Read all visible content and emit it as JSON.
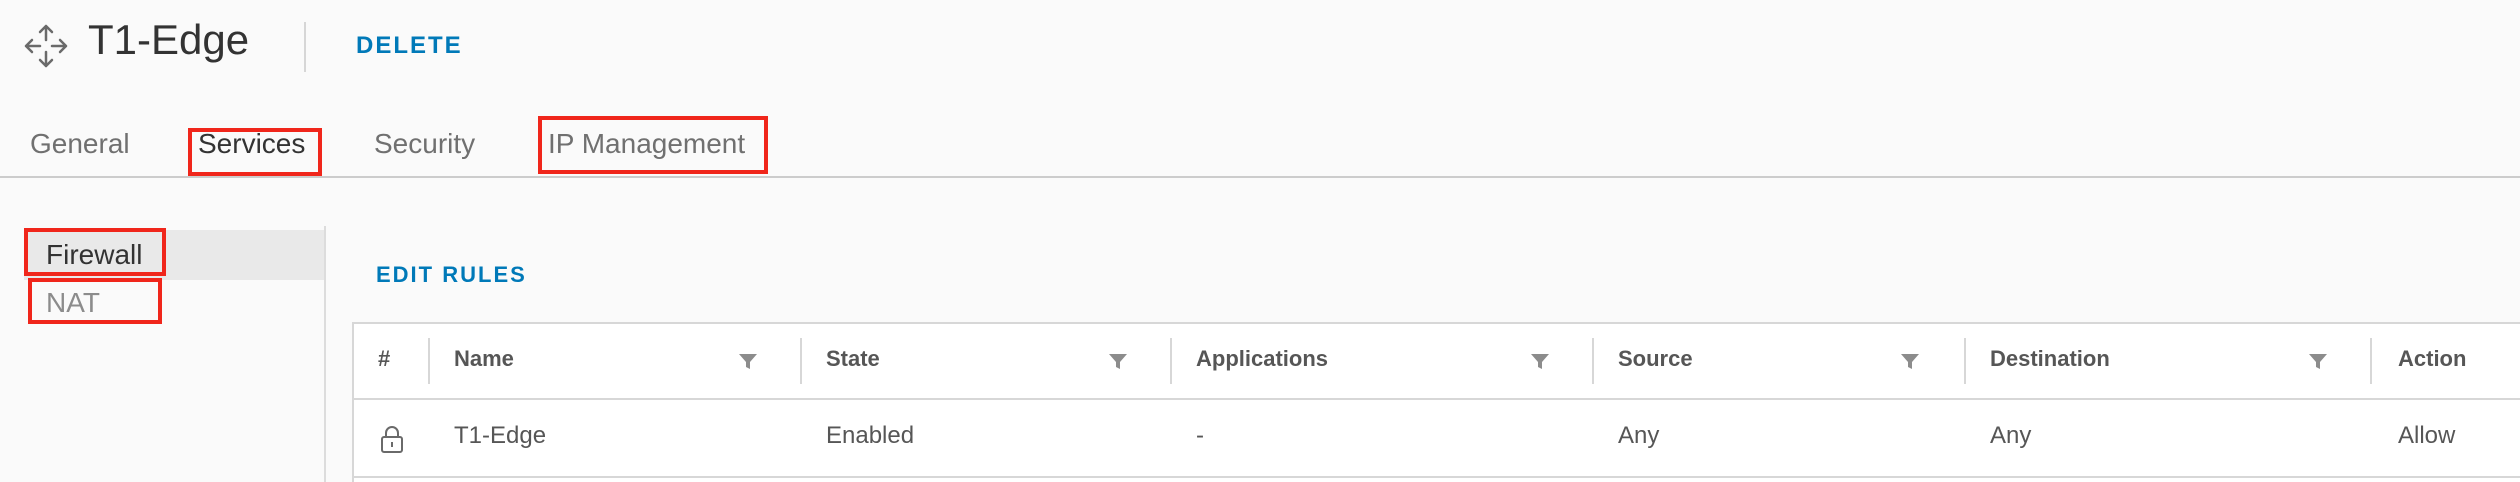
{
  "header": {
    "title": "T1-Edge",
    "delete_label": "DELETE",
    "icon": "move-arrows-icon"
  },
  "tabs": [
    {
      "label": "General",
      "active": false
    },
    {
      "label": "Services",
      "active": true,
      "highlighted": true
    },
    {
      "label": "Security",
      "active": false
    },
    {
      "label": "IP Management",
      "active": false,
      "highlighted": true
    }
  ],
  "sidenav": {
    "items": [
      {
        "label": "Firewall",
        "active": true,
        "highlighted": true
      },
      {
        "label": "NAT",
        "active": false,
        "highlighted": true
      }
    ]
  },
  "edit_rules_label": "EDIT RULES",
  "grid": {
    "columns": [
      "#",
      "Name",
      "State",
      "Applications",
      "Source",
      "Destination",
      "Action"
    ],
    "rows": [
      {
        "number_icon": "lock-icon",
        "name": "T1-Edge",
        "state": "Enabled",
        "applications": "-",
        "source": "Any",
        "destination": "Any",
        "action": "Allow"
      }
    ]
  },
  "colors": {
    "accent": "#0079b8",
    "highlight": "#f0261b",
    "active_side_bg": "#e9e9e9"
  }
}
